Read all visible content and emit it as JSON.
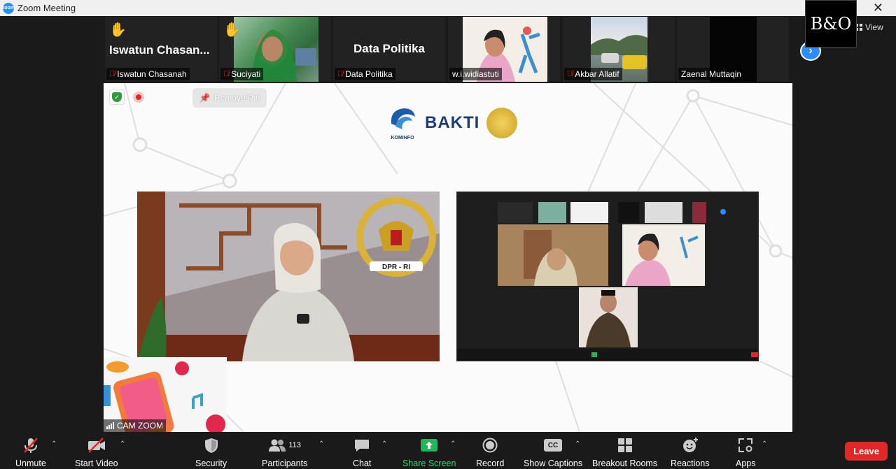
{
  "window": {
    "title": "Zoom Meeting"
  },
  "topbar": {
    "view_label": "View",
    "brand_logo_text": "B&O"
  },
  "participants_strip": [
    {
      "name": "Iswatun Chasanah",
      "display_title": "Iswatun  Chasan...",
      "hand_raised": true,
      "muted": true,
      "video": false
    },
    {
      "name": "Suciyati",
      "hand_raised": true,
      "muted": true,
      "video": true
    },
    {
      "name": "Data Politika",
      "display_title": "Data Politika",
      "hand_raised": false,
      "muted": true,
      "video": false
    },
    {
      "name": "w.i.widiastuti",
      "hand_raised": false,
      "muted": false,
      "video": true
    },
    {
      "name": "Akbar Allatif",
      "hand_raised": false,
      "muted": true,
      "video": true
    },
    {
      "name": "Zaenal Muttaqin",
      "hand_raised": false,
      "muted": false,
      "video": true
    }
  ],
  "share": {
    "remove_pin_label": "Remove Pin",
    "kominfo_label": "KOMINFO",
    "bakti_label": "BAKTI",
    "dpr_label": "DPR - RI",
    "cam_label": "CAM ZOOM"
  },
  "toolbar": {
    "unmute": "Unmute",
    "start_video": "Start Video",
    "security": "Security",
    "participants": "Participants",
    "participants_count": "113",
    "chat": "Chat",
    "share_screen": "Share Screen",
    "record": "Record",
    "show_captions": "Show Captions",
    "cc_icon_text": "CC",
    "breakout_rooms": "Breakout Rooms",
    "reactions": "Reactions",
    "apps": "Apps",
    "leave": "Leave"
  },
  "colors": {
    "accent": "#2d8cff",
    "share_green": "#23b45c",
    "leave_red": "#e02828"
  }
}
